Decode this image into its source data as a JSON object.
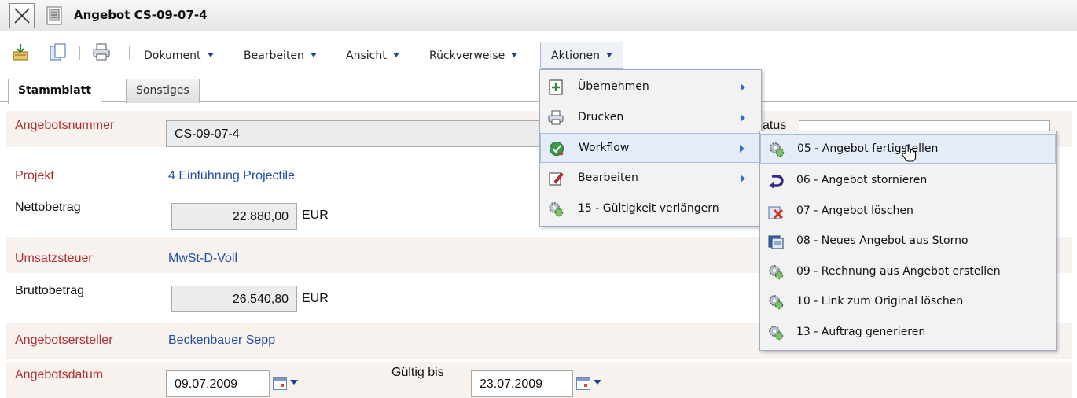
{
  "window": {
    "title": "Angebot CS-09-07-4"
  },
  "toolbar": {
    "menus": [
      "Dokument",
      "Bearbeiten",
      "Ansicht",
      "Rückverweise",
      "Aktionen"
    ]
  },
  "tabs": [
    {
      "label": "Stammblatt",
      "active": true
    },
    {
      "label": "Sonstiges",
      "active": false
    }
  ],
  "form": {
    "angebotsnummer": {
      "label": "Angebotsnummer",
      "value": "CS-09-07-4"
    },
    "status": {
      "label": "atus"
    },
    "projekt": {
      "label": "Projekt",
      "value": "4 Einführung Projectile"
    },
    "nettobetrag": {
      "label": "Nettobetrag",
      "value": "22.880,00",
      "unit": "EUR"
    },
    "umsatzsteuer": {
      "label": "Umsatzsteuer",
      "value": "MwSt-D-Voll"
    },
    "bruttobetrag": {
      "label": "Bruttobetrag",
      "value": "26.540,80",
      "unit": "EUR"
    },
    "angebotsersteller": {
      "label": "Angebotsersteller",
      "value": "Beckenbauer Sepp"
    },
    "angebotsdatum": {
      "label": "Angebotsdatum",
      "value": "09.07.2009"
    },
    "gueltig_bis": {
      "label": "Gültig bis",
      "value": "23.07.2009"
    }
  },
  "aktionen_menu": [
    {
      "label": "Übernehmen",
      "icon": "add-document-icon",
      "submenu": true
    },
    {
      "label": "Drucken",
      "icon": "printer-icon",
      "submenu": true
    },
    {
      "label": "Workflow",
      "icon": "workflow-icon",
      "submenu": true,
      "highlighted": true
    },
    {
      "label": "Bearbeiten",
      "icon": "edit-icon",
      "submenu": true
    },
    {
      "label": "15 - Gültigkeit verlängern",
      "icon": "gear-icon",
      "submenu": false
    }
  ],
  "workflow_submenu": [
    {
      "label": "05 - Angebot fertigstellen",
      "icon": "gear-icon",
      "highlighted": true
    },
    {
      "label": "06 - Angebot stornieren",
      "icon": "undo-arrow-icon"
    },
    {
      "label": "07 - Angebot löschen",
      "icon": "delete-icon"
    },
    {
      "label": "08 - Neues Angebot aus Storno",
      "icon": "copy-document-icon"
    },
    {
      "label": "09 - Rechnung aus Angebot erstellen",
      "icon": "gear-icon"
    },
    {
      "label": "10 - Link zum Original löschen",
      "icon": "gear-icon"
    },
    {
      "label": "13 - Auftrag generieren",
      "icon": "gear-icon"
    }
  ],
  "colors": {
    "required_label": "#b03030",
    "link": "#2050a0",
    "accent": "#2f6bd6"
  }
}
